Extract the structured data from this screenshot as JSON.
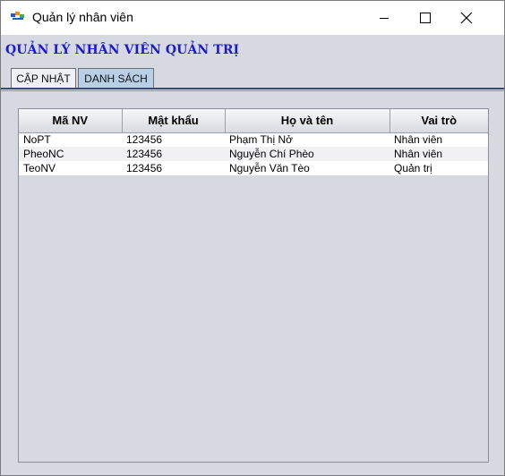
{
  "window": {
    "title": "Quản lý nhân viên",
    "app_icon": "fpt-logo-icon"
  },
  "header": {
    "title": "QUẢN LÝ NHÂN VIÊN QUẢN TRỊ"
  },
  "tabs": [
    {
      "label": "CẬP NHẬT",
      "selected": false
    },
    {
      "label": "DANH SÁCH",
      "selected": true
    }
  ],
  "table": {
    "columns": [
      "Mã NV",
      "Mật khẩu",
      "Họ và tên",
      "Vai trò"
    ],
    "rows": [
      [
        "NoPT",
        "123456",
        "Phạm Thị Nở",
        "Nhân viên"
      ],
      [
        "PheoNC",
        "123456",
        "Nguyễn Chí Phèo",
        "Nhân viên"
      ],
      [
        "TeoNV",
        "123456",
        "Nguyễn Văn Tèo",
        "Quản trị"
      ]
    ]
  },
  "colors": {
    "heading": "#1a1ad6",
    "selected_tab": "#b8cfe5",
    "window_bg": "#d6d9df"
  }
}
